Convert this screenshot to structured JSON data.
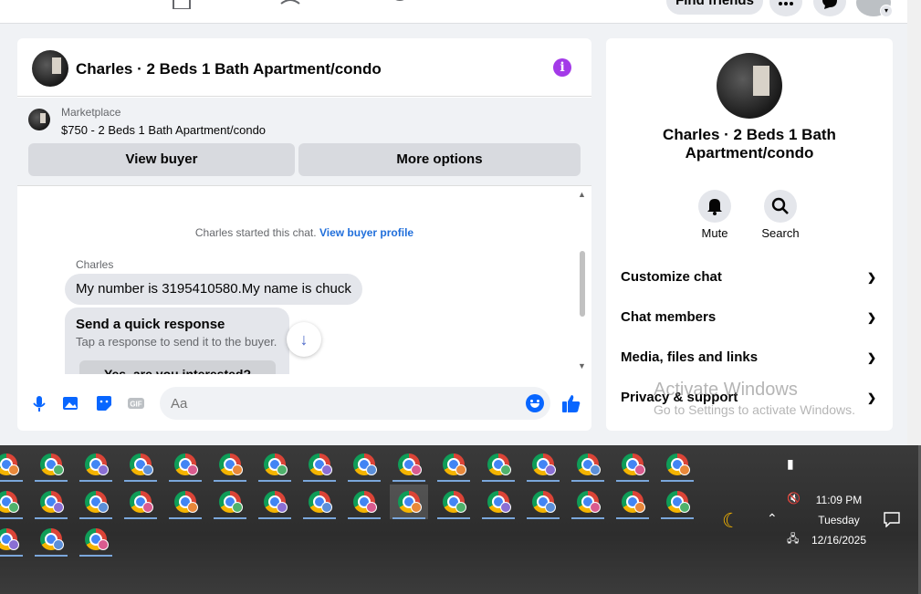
{
  "topnav": {
    "find_friends_label": "Find friends"
  },
  "chat": {
    "title": "Charles · 2 Beds 1 Bath Apartment/condo",
    "marketplace_label": "Marketplace",
    "listing_price_title": "$750 - 2 Beds 1 Bath Apartment/condo",
    "view_buyer_label": "View buyer",
    "more_options_label": "More options",
    "started_text": "Charles started this chat.",
    "view_buyer_profile_link": "View buyer profile",
    "sender_name": "Charles",
    "message_text": "My number is 3195410580.My name is chuck",
    "quick_title": "Send a quick response",
    "quick_subtitle": "Tap a response to send it to the buyer.",
    "quick_option": "Yes, are you interested?",
    "composer_placeholder": "Aa",
    "composer_icons": [
      "microphone-icon",
      "photo-icon",
      "sticker-icon",
      "gif-icon"
    ],
    "gif_label": "GIF"
  },
  "info_panel": {
    "title": "Charles · 2 Beds 1 Bath Apartment/condo",
    "actions": [
      {
        "label": "Mute",
        "icon": "bell-icon"
      },
      {
        "label": "Search",
        "icon": "search-icon"
      }
    ],
    "sections": [
      {
        "label": "Customize chat"
      },
      {
        "label": "Chat members"
      },
      {
        "label": "Media, files and links"
      },
      {
        "label": "Privacy & support"
      }
    ]
  },
  "watermark": {
    "line1": "Activate Windows",
    "line2": "Go to Settings to activate Windows."
  },
  "taskbar": {
    "icon": "chrome-icon",
    "badge_colors": [
      "#e8883a",
      "#4fb26c",
      "#8a6fd4",
      "#5b8fd9",
      "#d95b8f"
    ],
    "time": "11:09 PM",
    "day": "Tuesday",
    "date": "12/16/2025"
  },
  "colors": {
    "accent": "#0866ff",
    "info": "#a33ae8",
    "link": "#216fdb"
  }
}
